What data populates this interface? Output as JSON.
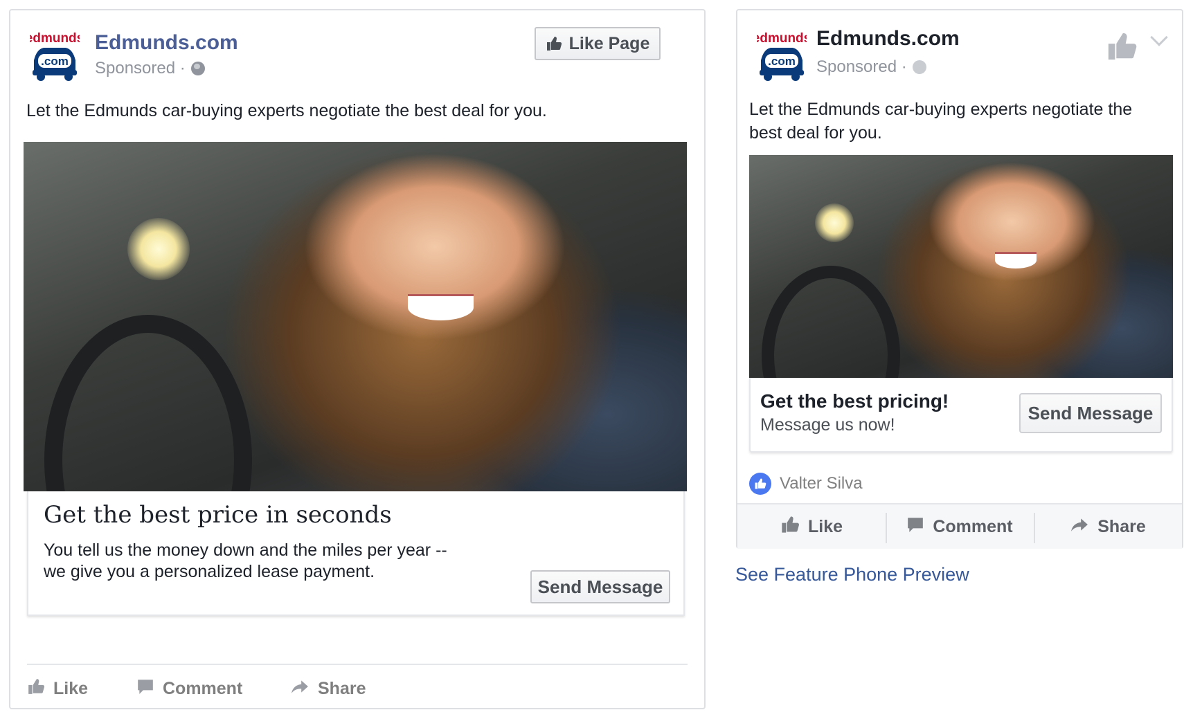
{
  "desktop": {
    "logo": {
      "top_text": "edmunds",
      "badge_text": ".com"
    },
    "page_name": "Edmunds.com",
    "sponsored": "Sponsored ·",
    "like_page_label": "Like Page",
    "post_text": "Let the Edmunds car-buying experts negotiate the best deal for you.",
    "headline": "Get the best price in seconds",
    "description": "You tell us the money down and the miles per year -- we give you a personalized lease payment.",
    "cta_label": "Send Message",
    "actions": {
      "like": "Like",
      "comment": "Comment",
      "share": "Share"
    }
  },
  "mobile": {
    "logo": {
      "top_text": "edmunds",
      "badge_text": ".com"
    },
    "page_name": "Edmunds.com",
    "sponsored": "Sponsored ·",
    "post_text": "Let the Edmunds car-buying experts negotiate the best deal for you.",
    "headline": "Get the best pricing!",
    "description": "Message us now!",
    "cta_label": "Send Message",
    "social_name": "Valter Silva",
    "actions": {
      "like": "Like",
      "comment": "Comment",
      "share": "Share"
    }
  },
  "feature_phone_link": "See Feature Phone Preview",
  "colors": {
    "brand_red": "#c8102e",
    "brand_blue": "#0a3a7a",
    "link_blue": "#365899",
    "page_name_blue": "#4b5e96",
    "like_badge_blue": "#4a78f0"
  },
  "icons": [
    "globe-icon",
    "thumbs-up-icon",
    "comment-icon",
    "share-icon",
    "chevron-down-icon",
    "like-badge-icon"
  ]
}
